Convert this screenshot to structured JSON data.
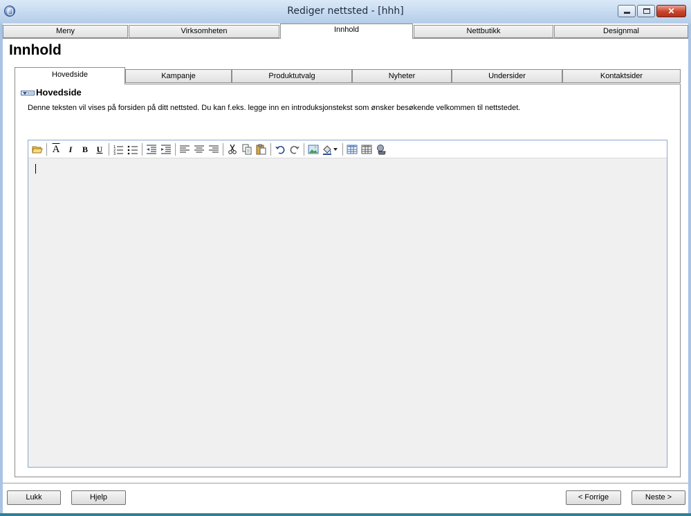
{
  "window": {
    "title": "Rediger nettsted - [hhh]",
    "min_glyph": "",
    "max_glyph": "",
    "close_glyph": "✕"
  },
  "main_tabs": [
    {
      "label": "Meny",
      "active": false
    },
    {
      "label": "Virksomheten",
      "active": false
    },
    {
      "label": "Innhold",
      "active": true
    },
    {
      "label": "Nettbutikk",
      "active": false
    },
    {
      "label": "Designmal",
      "active": false
    }
  ],
  "page": {
    "title": "Innhold"
  },
  "sub_tabs": [
    {
      "label": "Hovedside",
      "active": true
    },
    {
      "label": "Kampanje",
      "active": false
    },
    {
      "label": "Produktutvalg",
      "active": false
    },
    {
      "label": "Nyheter",
      "active": false
    },
    {
      "label": "Undersider",
      "active": false
    },
    {
      "label": "Kontaktsider",
      "active": false
    }
  ],
  "section": {
    "title": "Hovedside",
    "description": "Denne teksten vil vises på forsiden på ditt nettsted. Du kan f.eks. legge inn en introduksjonstekst som ønsker besøkende velkommen til nettstedet."
  },
  "editor": {
    "content": "",
    "toolbar": [
      "open-folder-icon",
      "font-icon",
      "italic-icon",
      "bold-icon",
      "underline-icon",
      "numbered-list-icon",
      "bullet-list-icon",
      "decrease-indent-icon",
      "increase-indent-icon",
      "align-left-icon",
      "align-center-icon",
      "align-right-icon",
      "cut-icon",
      "copy-icon",
      "paste-icon",
      "undo-icon",
      "redo-icon",
      "insert-image-icon",
      "color-dropdown-icon",
      "insert-table-icon",
      "table-properties-icon",
      "spellcheck-icon"
    ]
  },
  "footer": {
    "close_label": "Lukk",
    "help_label": "Hjelp",
    "prev_label": "< Forrige",
    "next_label": "Neste >"
  },
  "colors": {
    "accent": "#2f7f96",
    "frame": "#a9c4e4",
    "close_button": "#c8432a"
  }
}
